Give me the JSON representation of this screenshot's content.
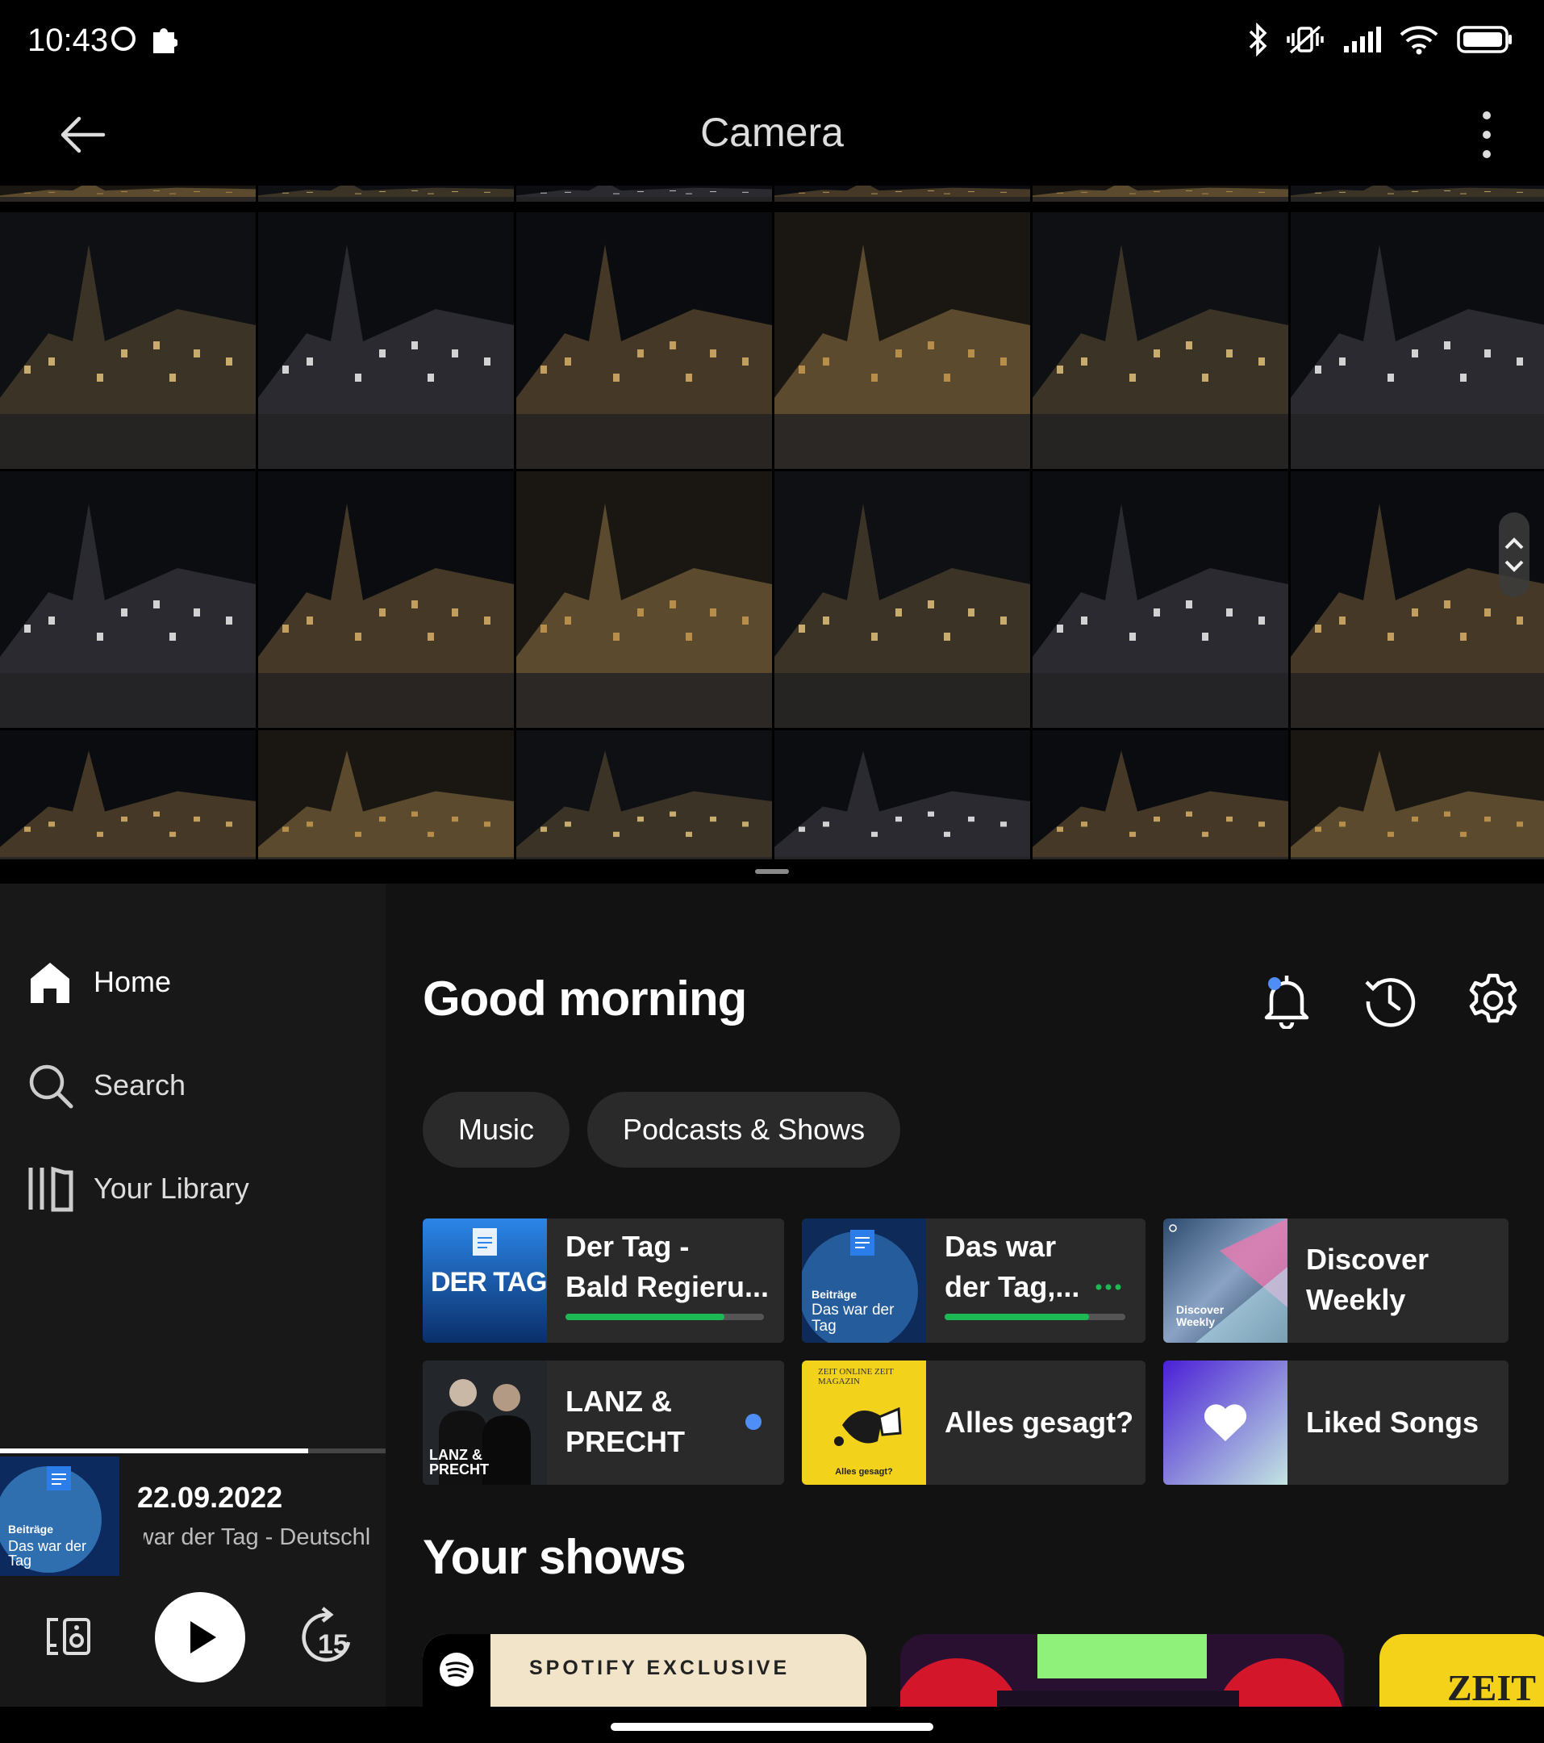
{
  "status_bar": {
    "time": "10:43"
  },
  "gallery": {
    "title": "Camera"
  },
  "spotify": {
    "sidebar": {
      "items": [
        {
          "label": "Home",
          "icon": "home-icon",
          "active": true
        },
        {
          "label": "Search",
          "icon": "search-icon",
          "active": false
        },
        {
          "label": "Your Library",
          "icon": "library-icon",
          "active": false
        }
      ]
    },
    "now_playing": {
      "title": "22.09.2022",
      "subtitle": "Das war der Tag - Deutschlandfunk",
      "progress_percent": 80,
      "art": {
        "tag": "Beiträge",
        "title": "Das war der Tag"
      },
      "skip_seconds": "15"
    },
    "greeting": "Good morning",
    "filters": [
      "Music",
      "Podcasts & Shows"
    ],
    "shortcuts": [
      {
        "label": "Der Tag - Bald Regieru...",
        "line1": "Der Tag -",
        "line2": "Bald Regieru...",
        "art_text": "DER TAG",
        "progress_percent": 80
      },
      {
        "label": "Das war der Tag,...",
        "line1": "Das war",
        "line2": "der Tag,...",
        "art_tag": "Beiträge",
        "art_title": "Das war der Tag",
        "progress_percent": 80
      },
      {
        "label": "Discover Weekly",
        "line1": "Discover",
        "line2": "Weekly",
        "art_text": "Discover Weekly"
      },
      {
        "label": "LANZ & PRECHT",
        "line1": "LANZ &",
        "line2": "PRECHT",
        "art_text": "LANZ & PRECHT",
        "new_episode": true
      },
      {
        "label": "Alles gesagt?",
        "line1": "Alles gesagt?",
        "art_text": "ZEIT ONLINE ZEIT MAGAZIN",
        "art_caption": "Alles gesagt?"
      },
      {
        "label": "Liked Songs",
        "line1": "Liked Songs"
      }
    ],
    "your_shows_title": "Your shows",
    "shows": [
      {
        "badge": "SPOTIFY EXCLUSIVE"
      },
      {
        "badge": ""
      },
      {
        "badge": "ZEIT"
      }
    ]
  },
  "colors": {
    "spotify_green": "#1db954",
    "background": "#121212",
    "sidebar": "#181818",
    "chip": "#2a2a2a",
    "blue_dot": "#4f8ef7"
  }
}
